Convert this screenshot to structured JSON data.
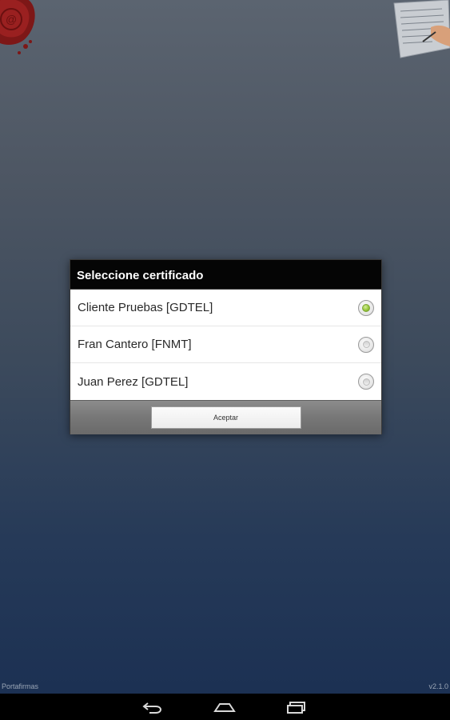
{
  "app": {
    "footer_left": "Portafirmas",
    "version": "v2.1.0"
  },
  "dialog": {
    "title": "Seleccione certificado",
    "options": [
      {
        "label": "Cliente Pruebas [GDTEL]",
        "selected": true
      },
      {
        "label": "Fran Cantero [FNMT]",
        "selected": false
      },
      {
        "label": "Juan Perez [GDTEL]",
        "selected": false
      }
    ],
    "accept_label": "Aceptar"
  },
  "navbar": {
    "icons": [
      "back-icon",
      "home-icon",
      "recent-apps-icon"
    ]
  },
  "decor": {
    "seal_color": "#8b1a1a",
    "accent_green": "#96c83a"
  }
}
